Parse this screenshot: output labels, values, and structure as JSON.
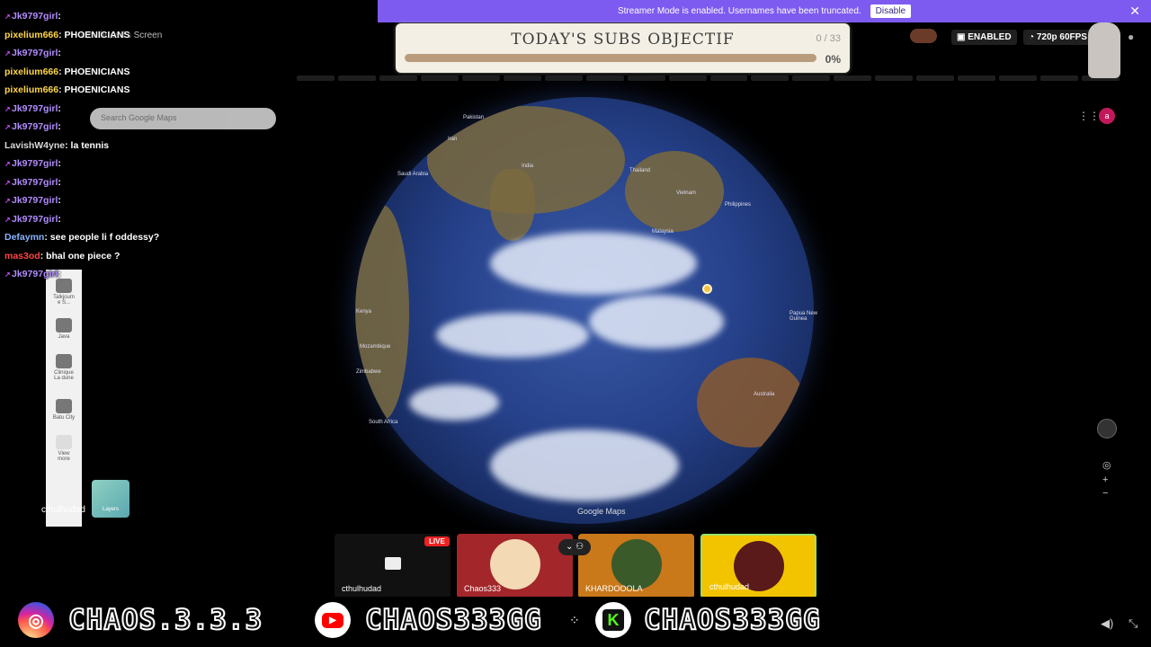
{
  "streamer_bar": {
    "message": "Streamer Mode is enabled. Usernames have been truncated.",
    "disable_label": "Disable",
    "close_icon": "close-icon"
  },
  "subs_goal": {
    "title": "TODAY'S SUBS OBJECTIF",
    "count": "0 / 33",
    "percent_label": "0%",
    "progress": 0.0
  },
  "status": {
    "enabled_label": "ENABLED",
    "quality_label": "720p 60FPS"
  },
  "screen": {
    "share_label": "cthulhudad's Screen",
    "search_placeholder": "Search Google Maps",
    "layers_label": "Layers",
    "maps_watermark": "Google Maps",
    "sidebar_items": [
      "Talkjoum e S...",
      "Java",
      "Clinique La dune",
      "Batu City",
      "View more"
    ],
    "places": [
      "Pakistan",
      "India",
      "Thailand",
      "Vietnam",
      "Philippines",
      "Malaysia",
      "Papua New Guinea",
      "Australia",
      "Mozambique",
      "South Africa",
      "Zimbabwe",
      "Saudi Arabia",
      "Iran",
      "Kenya"
    ]
  },
  "chat": {
    "messages": [
      {
        "user": "Jk9797girl",
        "text": ":",
        "color": "purple"
      },
      {
        "user": "pixelium666",
        "text": ": PHOENICIANS",
        "color": "yellow"
      },
      {
        "user": "Jk9797girl",
        "text": ":",
        "color": "purple"
      },
      {
        "user": "pixelium666",
        "text": ": PHOENICIANS",
        "color": "yellow"
      },
      {
        "user": "pixelium666",
        "text": ": PHOENICIANS",
        "color": "yellow"
      },
      {
        "user": "Jk9797girl",
        "text": ":",
        "color": "purple"
      },
      {
        "user": "Jk9797girl",
        "text": ":",
        "color": "purple"
      },
      {
        "user": "LavishW4yne",
        "text": ": la tennis",
        "color": "white"
      },
      {
        "user": "Jk9797girl",
        "text": ":",
        "color": "purple"
      },
      {
        "user": "Jk9797girl",
        "text": ":",
        "color": "purple"
      },
      {
        "user": "Jk9797girl",
        "text": ":",
        "color": "purple"
      },
      {
        "user": "Jk9797girl",
        "text": ":",
        "color": "purple"
      },
      {
        "user": "Defaymn",
        "text": ": see people li f oddessy?",
        "color": "blue"
      },
      {
        "user": "mas3od",
        "text": ": bhal one piece ?",
        "color": "red"
      },
      {
        "user": "Jk9797girl",
        "text": ":",
        "color": "purple"
      }
    ]
  },
  "participants": {
    "live_label": "LIVE",
    "tiles": [
      {
        "name": "cthulhudad",
        "bg": "#111111"
      },
      {
        "name": "Chaos333",
        "bg": "#a3262a"
      },
      {
        "name": "KHARDOOOLA",
        "bg": "#c9781a"
      },
      {
        "name": "cthulhudad",
        "bg": "#f2c400"
      }
    ],
    "presenter_label": "cthulhudad"
  },
  "socials": {
    "instagram": "CHAOS.3.3.3",
    "youtube": "CHAOS333GG",
    "kick": "CHAOS333GG"
  },
  "colors": {
    "accent": "#7d5bf0",
    "instagram": "#d62976",
    "youtube": "#ff0000",
    "kick": "#53fc18"
  }
}
